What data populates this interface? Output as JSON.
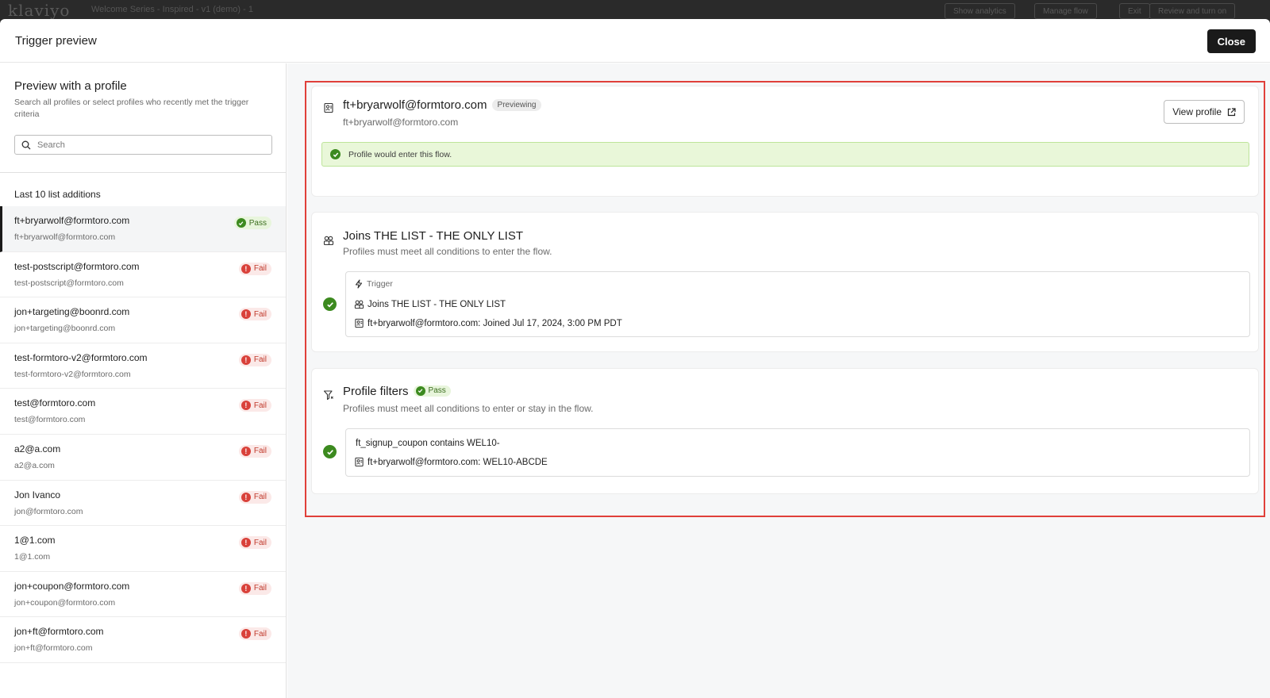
{
  "background": {
    "logo": "klaviyo",
    "title": "Welcome Series - Inspired - v1 (demo) - 1",
    "buttons": [
      "Show analytics",
      "Manage flow",
      "Exit",
      "Review and turn on"
    ]
  },
  "modal": {
    "title": "Trigger preview",
    "close_label": "Close"
  },
  "left": {
    "title": "Preview with a profile",
    "subtitle": "Search all profiles or select profiles who recently met the trigger criteria",
    "search_placeholder": "Search",
    "list_title": "Last 10 list additions",
    "profiles": [
      {
        "name": "ft+bryarwolf@formtoro.com",
        "email": "ft+bryarwolf@formtoro.com",
        "status": "Pass"
      },
      {
        "name": "test-postscript@formtoro.com",
        "email": "test-postscript@formtoro.com",
        "status": "Fail"
      },
      {
        "name": "jon+targeting@boonrd.com",
        "email": "jon+targeting@boonrd.com",
        "status": "Fail"
      },
      {
        "name": "test-formtoro-v2@formtoro.com",
        "email": "test-formtoro-v2@formtoro.com",
        "status": "Fail"
      },
      {
        "name": "test@formtoro.com",
        "email": "test@formtoro.com",
        "status": "Fail"
      },
      {
        "name": "a2@a.com",
        "email": "a2@a.com",
        "status": "Fail"
      },
      {
        "name": "Jon Ivanco",
        "email": "jon@formtoro.com",
        "status": "Fail"
      },
      {
        "name": "1@1.com",
        "email": "1@1.com",
        "status": "Fail"
      },
      {
        "name": "jon+coupon@formtoro.com",
        "email": "jon+coupon@formtoro.com",
        "status": "Fail"
      },
      {
        "name": "jon+ft@formtoro.com",
        "email": "jon+ft@formtoro.com",
        "status": "Fail"
      }
    ]
  },
  "preview": {
    "name": "ft+bryarwolf@formtoro.com",
    "tag": "Previewing",
    "email": "ft+bryarwolf@formtoro.com",
    "view_profile_label": "View profile",
    "success_message": "Profile would enter this flow."
  },
  "trigger_section": {
    "title": "Joins THE LIST - THE ONLY LIST",
    "subtitle": "Profiles must meet all conditions to enter the flow.",
    "trigger_label": "Trigger",
    "trigger_name": "Joins THE LIST - THE ONLY LIST",
    "detail": "ft+bryarwolf@formtoro.com: Joined Jul 17, 2024, 3:00 PM PDT"
  },
  "filters_section": {
    "title": "Profile filters",
    "status": "Pass",
    "subtitle": "Profiles must meet all conditions to enter or stay in the flow.",
    "condition": "ft_signup_coupon contains WEL10-",
    "detail": "ft+bryarwolf@formtoro.com: WEL10-ABCDE"
  },
  "colors": {
    "pass": "#3c8a1f",
    "fail": "#d9413a",
    "highlight": "#e0403a",
    "success_bg": "#e9f7d9"
  }
}
